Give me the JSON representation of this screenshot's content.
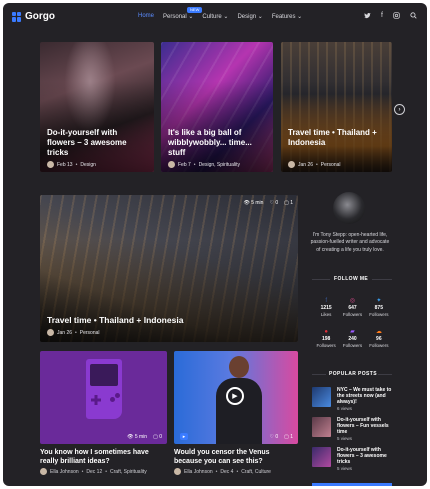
{
  "brand": {
    "name": "Gorgo",
    "accent": "#3a7bff"
  },
  "nav": {
    "items": [
      {
        "label": "Home"
      },
      {
        "label": "Personal ⌄",
        "badge": "NEW"
      },
      {
        "label": "Culture ⌄"
      },
      {
        "label": "Design ⌄"
      },
      {
        "label": "Features ⌄"
      }
    ],
    "icons": [
      "twitter-icon",
      "facebook-icon",
      "instagram-icon",
      "search-icon"
    ]
  },
  "featured": [
    {
      "title": "Do-it-yourself with flowers – 3 awesome tricks",
      "date": "Feb 13",
      "category": "Design"
    },
    {
      "title": "It's like a big ball of wibblywobbly... time... stuff",
      "date": "Feb 7",
      "category": "Design, Spirituality"
    },
    {
      "title": "Travel time • Thailand + Indonesia",
      "date": "Jan 26",
      "category": "Personal"
    }
  ],
  "hero": {
    "title": "Travel time • Thailand + Indonesia",
    "date": "Jan 26",
    "category": "Personal",
    "read_time": "5 min",
    "likes": "0",
    "comments": "1"
  },
  "posts": [
    {
      "title": "You know how I sometimes have really brilliant ideas?",
      "author": "Ella Johnson",
      "date": "Dec 12",
      "category": "Craft, Spirituality",
      "read_time": "5 min",
      "comments": "0"
    },
    {
      "title": "Would you censor the Venus because you can see this?",
      "author": "Ella Johnson",
      "date": "Dec 4",
      "category": "Craft, Culture",
      "likes": "0",
      "comments": "1"
    }
  ],
  "sidebar": {
    "bio": "I'm Tony Stepp: open-hearted life, passion-fuelled writer and advocate of creating a life you truly love.",
    "follow_title": "FOLLOW ME",
    "follow": [
      {
        "icon": "facebook-icon",
        "count": "1215",
        "label": "Likes"
      },
      {
        "icon": "instagram-icon",
        "count": "647",
        "label": "Followers"
      },
      {
        "icon": "twitter-icon",
        "count": "875",
        "label": "Followers"
      },
      {
        "icon": "pinterest-icon",
        "count": "198",
        "label": "Followers"
      },
      {
        "icon": "twitch-icon",
        "count": "240",
        "label": "Followers"
      },
      {
        "icon": "soundcloud-icon",
        "count": "96",
        "label": "Followers"
      }
    ],
    "popular_title": "POPULAR POSTS",
    "popular": [
      {
        "title": "NYC – We must take to the streets now (and always)!",
        "views": "6 views",
        "color": "#2a5fb0"
      },
      {
        "title": "Do-it-yourself with flowers – Fun vessels time",
        "views": "5 views",
        "color": "#a05a7a"
      },
      {
        "title": "Do-it-yourself with flowers – 3 awesome tricks",
        "views": "5 views",
        "color": "#6a3a9a"
      }
    ]
  }
}
